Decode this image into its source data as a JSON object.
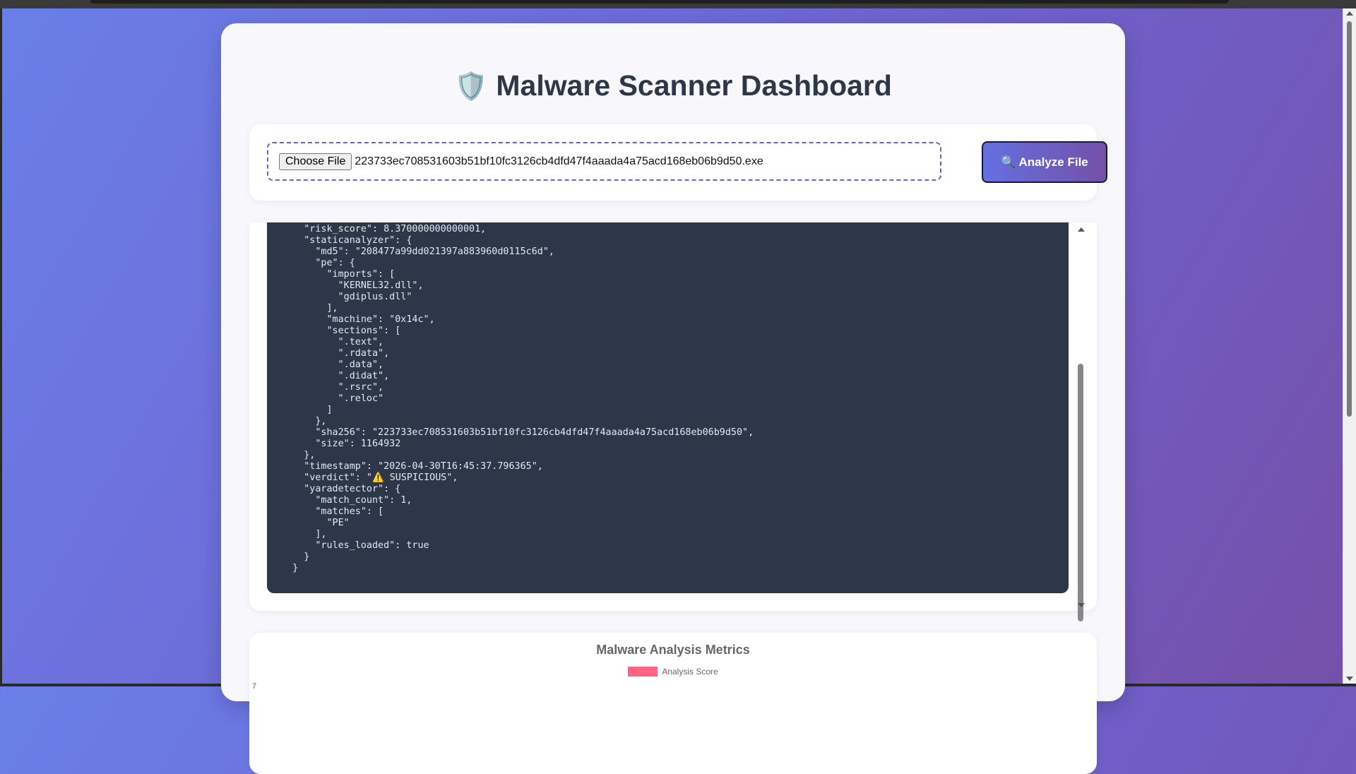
{
  "page": {
    "title_icon": "🛡️",
    "title": "Malware Scanner Dashboard"
  },
  "upload": {
    "choose_label": "Choose File",
    "filename": "223733ec708531603b51bf10fc3126cb4dfd47f4aaada4a75acd168eb06b9d50.exe",
    "analyze_label": "🔍 Analyze File"
  },
  "results": {
    "json_text": "    },\n    \"risk_score\": 8.370000000000001,\n    \"staticanalyzer\": {\n      \"md5\": \"208477a99dd021397a883960d0115c6d\",\n      \"pe\": {\n        \"imports\": [\n          \"KERNEL32.dll\",\n          \"gdiplus.dll\"\n        ],\n        \"machine\": \"0x14c\",\n        \"sections\": [\n          \".text\",\n          \".rdata\",\n          \".data\",\n          \".didat\",\n          \".rsrc\",\n          \".reloc\"\n        ]\n      },\n      \"sha256\": \"223733ec708531603b51bf10fc3126cb4dfd47f4aaada4a75acd168eb06b9d50\",\n      \"size\": 1164932\n    },\n    \"timestamp\": \"2026-04-30T16:45:37.796365\",\n    \"verdict\": \"⚠️ SUSPICIOUS\",\n    \"yaradetector\": {\n      \"match_count\": 1,\n      \"matches\": [\n        \"PE\"\n      ],\n      \"rules_loaded\": true\n    }\n  }"
  },
  "metrics": {
    "title": "Malware Analysis Metrics",
    "legend_label": "Analysis Score",
    "legend_color": "#ff6384",
    "first_tick": "7"
  },
  "colors": {
    "accent": "#5a67d8",
    "code_bg": "#2d3748"
  }
}
